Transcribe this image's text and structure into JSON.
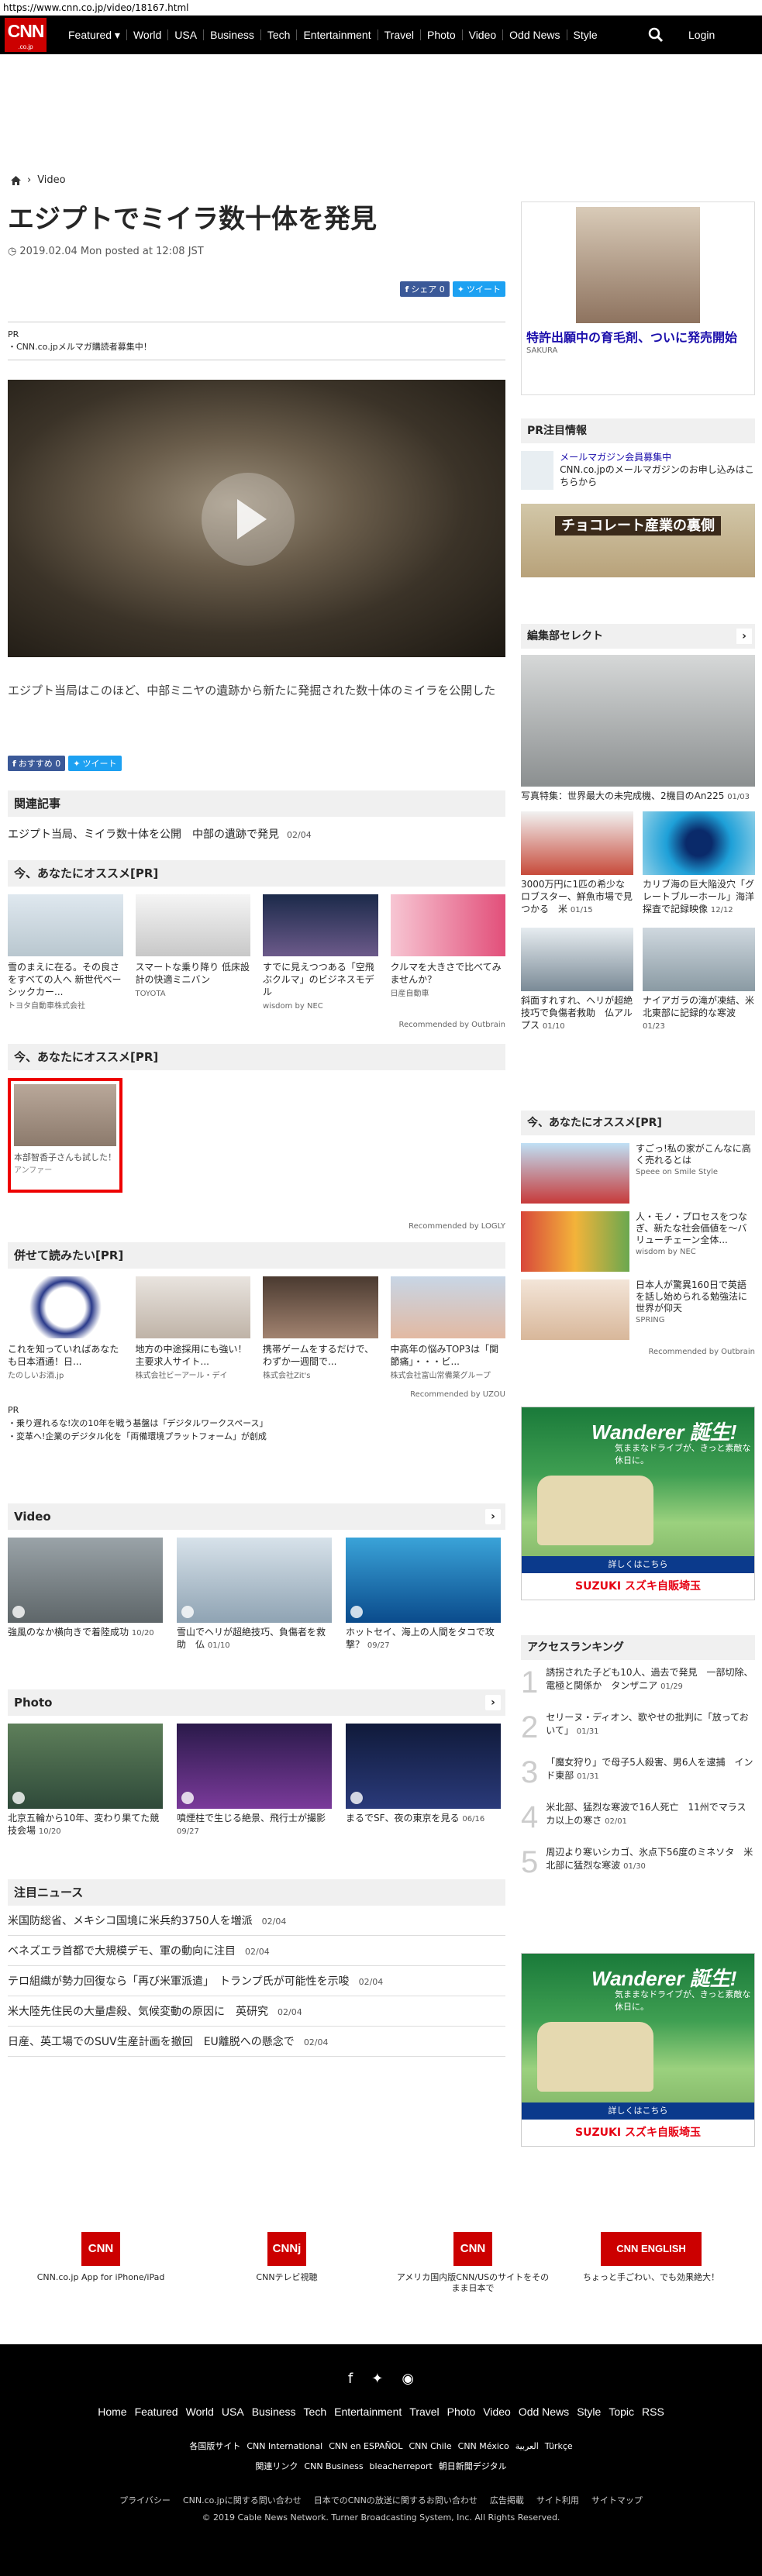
{
  "url": "https://www.cnn.co.jp/video/18167.html",
  "nav": {
    "logo": "CNN",
    "logo_sub": ".co.jp",
    "links": [
      "Featured ▾",
      "World",
      "USA",
      "Business",
      "Tech",
      "Entertainment",
      "Travel",
      "Photo",
      "Video",
      "Odd News",
      "Style"
    ],
    "login": "Login"
  },
  "breadcrumb": {
    "section": "Video"
  },
  "article": {
    "title": "エジプトでミイラ数十体を発見",
    "date": "2019.02.04 Mon posted at 12:08 JST",
    "share_fb": "シェア 0",
    "share_tw": "ツイート",
    "pr_label": "PR",
    "pr_text": "CNN.co.jpメルマガ購読者募集中！",
    "caption": "エジプト当局はこのほど、中部ミニヤの遺跡から新たに発掘された数十体のミイラを公開した",
    "like": "おすすめ 0",
    "tweet": "ツイート"
  },
  "related": {
    "title": "関連記事",
    "items": [
      {
        "text": "エジプト当局、ミイラ数十体を公開　中部の遺跡で発見",
        "date": "02/04"
      }
    ]
  },
  "outbrain1": {
    "title": "今、あなたにオススメ[PR]",
    "cards": [
      {
        "text": "雪のまえに在る。その良さをすべての人へ 新世代ベーシックカー...",
        "src": "トヨタ自動車株式会社"
      },
      {
        "text": "スマートな乗り降り 低床設計の快適ミニバン",
        "src": "TOYOTA"
      },
      {
        "text": "すでに見えつつある「空飛ぶクルマ」のビジネスモデル",
        "src": "wisdom by NEC"
      },
      {
        "text": "クルマを大きさで比べてみませんか？",
        "src": "日産自動車"
      }
    ],
    "rec": "Recommended by Outbrain"
  },
  "logly": {
    "title": "今、あなたにオススメ[PR]",
    "card": {
      "text": "本部智香子さんも試した！",
      "src": "アンファー"
    },
    "rec": "Recommended by LOGLY"
  },
  "uzou": {
    "title": "併せて読みたい[PR]",
    "cards": [
      {
        "text": "これを知っていればあなたも日本酒通！日...",
        "src": "たのしいお酒.jp"
      },
      {
        "text": "地方の中途採用にも強い！主要求人サイト...",
        "src": "株式会社ビーアール・デイ"
      },
      {
        "text": "携帯ゲームをするだけで、わずか一週間で...",
        "src": "株式会社Zit's"
      },
      {
        "text": "中高年の悩みTOP3は「関節痛」・・・ビ...",
        "src": "株式会社富山常備薬グループ"
      }
    ],
    "rec": "Recommended by UZOU",
    "pr_label": "PR",
    "pr_items": [
      "乗り遅れるな!次の10年を戦う基盤は「デジタルワークスペース」",
      "変革へ!企業のデジタル化を「両備環境プラットフォーム」が創成"
    ]
  },
  "video": {
    "title": "Video",
    "items": [
      {
        "text": "強風のなか横向きで着陸成功",
        "date": "10/20"
      },
      {
        "text": "雪山でヘリが超絶技巧、負傷者を救助　仏",
        "date": "01/10"
      },
      {
        "text": "ホットセイ、海上の人間をタコで攻撃？",
        "date": "09/27"
      }
    ]
  },
  "photo": {
    "title": "Photo",
    "items": [
      {
        "text": "北京五輪から10年、変わり果てた競技会場",
        "date": "10/20"
      },
      {
        "text": "噴煙柱で生じる絶景、飛行士が撮影",
        "date": "09/27"
      },
      {
        "text": "まるでSF、夜の東京を見る",
        "date": "06/16"
      }
    ]
  },
  "news": {
    "title": "注目ニュース",
    "items": [
      {
        "text": "米国防総省、メキシコ国境に米兵約3750人を増派",
        "date": "02/04"
      },
      {
        "text": "ベネズエラ首都で大規模デモ、軍の動向に注目",
        "date": "02/04"
      },
      {
        "text": "テロ組織が勢力回復なら「再び米軍派遣」　トランプ氏が可能性を示唆",
        "date": "02/04"
      },
      {
        "text": "米大陸先住民の大量虐殺、気候変動の原因に　英研究",
        "date": "02/04"
      },
      {
        "text": "日産、英工場でのSUV生産計画を撤回　EU離脱への懸念で",
        "date": "02/04"
      }
    ]
  },
  "side": {
    "ad1": {
      "text": "特許出願中の育毛剤、ついに発売開始",
      "src": "SAKURA"
    },
    "pr": {
      "title": "PR注目情報",
      "link": "メールマガジン会員募集中",
      "desc": "CNN.co.jpのメールマガジンのお申し込みはこちらから",
      "banner": "チョコレート産業の裏側"
    },
    "editor": {
      "title": "編集部セレクト",
      "main": {
        "text": "写真特集：世界最大の未完成機、2機目のAn225",
        "date": "01/03"
      },
      "items": [
        {
          "text": "3000万円に1匹の希少なロブスター、鮮魚市場で見つかる　米",
          "date": "01/15"
        },
        {
          "text": "カリブ海の巨大陥没穴「グレートブルーホール」海洋探査で記録映像",
          "date": "12/12"
        },
        {
          "text": "斜面すれすれ、ヘリが超絶技巧で負傷者救助　仏アルプス",
          "date": "01/10"
        },
        {
          "text": "ナイアガラの滝が凍結、米北東部に記録的な寒波",
          "date": "01/23"
        }
      ]
    },
    "outbrain": {
      "title": "今、あなたにオススメ[PR]",
      "items": [
        {
          "text": "すごっ!私の家がこんなに高く売れるとは",
          "src": "Speee on Smile Style"
        },
        {
          "text": "人・モノ・プロセスをつなぎ、新たな社会価値を～バリューチェーン全体...",
          "src": "wisdom by NEC"
        },
        {
          "text": "日本人が驚異160日で英語を話し始められる勉強法に世界が仰天",
          "src": "SPRING"
        }
      ],
      "rec": "Recommended by Outbrain"
    },
    "suzuki": {
      "brand": "Wanderer",
      "tag": "誕生!",
      "sub": "気ままなドライブが、きっと素敵な休日に。",
      "btn": "詳しくはこちら",
      "maker": "SUZUKI スズキ自販埼玉"
    },
    "ranking": {
      "title": "アクセスランキング",
      "items": [
        {
          "n": "1",
          "text": "誘拐された子ども10人、過去で発見　一部切除、電極と関係か　タンザニア",
          "date": "01/29"
        },
        {
          "n": "2",
          "text": "セリーヌ・ディオン、歌やせの批判に「放っておいて」",
          "date": "01/31"
        },
        {
          "n": "3",
          "text": "「魔女狩り」で母子5人殺害、男6人を逮捕　インド東部",
          "date": "01/31"
        },
        {
          "n": "4",
          "text": "米北部、猛烈な寒波で16人死亡　11州でマラスカ以上の寒さ",
          "date": "02/01"
        },
        {
          "n": "5",
          "text": "周辺より寒いシカゴ、氷点下56度のミネソタ　米北部に猛烈な寒波",
          "date": "01/30"
        }
      ]
    }
  },
  "apps": [
    {
      "icon": "CNN",
      "text": "CNN.co.jp App for iPhone/iPad"
    },
    {
      "icon": "CNNj",
      "text": "CNNテレビ視聴"
    },
    {
      "icon": "CNN",
      "text": "アメリカ国内版CNN/USのサイトをそのまま日本で"
    },
    {
      "icon": "CNN ENGLISH",
      "text": "ちょっと手ごわい、でも効果絶大！"
    }
  ],
  "footer": {
    "nav": [
      "Home",
      "Featured",
      "World",
      "USA",
      "Business",
      "Tech",
      "Entertainment",
      "Travel",
      "Photo",
      "Video",
      "Odd News",
      "Style",
      "Topic",
      "RSS"
    ],
    "editions": [
      "各国版サイト",
      "CNN International",
      "CNN en ESPAÑOL",
      "CNN Chile",
      "CNN México",
      "العربية",
      "Türkçe"
    ],
    "related": [
      "関連リンク",
      "CNN Business",
      "bleacherreport",
      "朝日新聞デジタル"
    ],
    "bottom": [
      "プライバシー",
      "CNN.co.jpに関する問い合わせ",
      "日本でのCNNの放送に関するお問い合わせ",
      "広告掲載",
      "サイト利用",
      "サイトマップ"
    ],
    "copyright": "© 2019 Cable News Network. Turner Broadcasting System, Inc. All Rights Reserved."
  },
  "colors": {
    "brand": "#cc0000",
    "nav": "#000000",
    "facebook": "#3b5998",
    "twitter": "#1da1f2"
  }
}
